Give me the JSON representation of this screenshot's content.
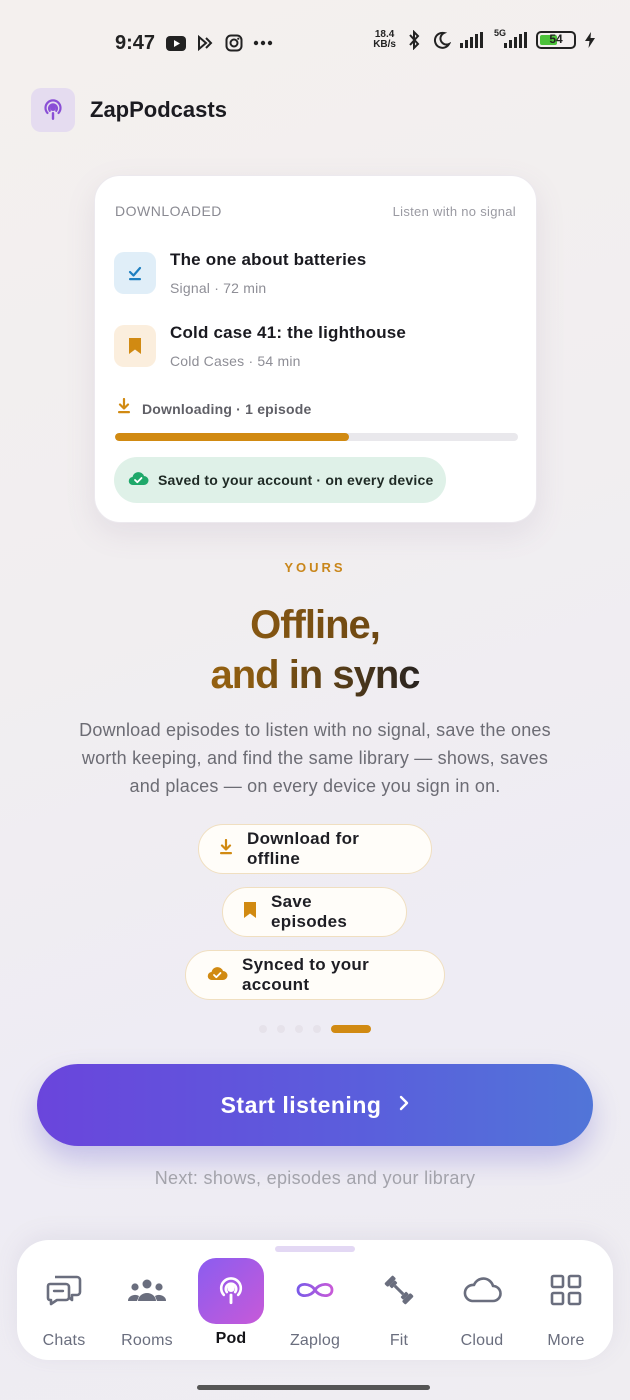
{
  "status": {
    "time": "9:47",
    "speed_top": "18.4",
    "speed_bottom": "KB/s",
    "network": "5G",
    "battery": "54",
    "icons_left": [
      "youtube-icon",
      "app-icon",
      "instagram-icon",
      "more-dots-icon"
    ],
    "icons_right": [
      "bluetooth-icon",
      "moon-icon",
      "signal-icon",
      "signal-5g-icon",
      "battery-icon",
      "charging-icon"
    ]
  },
  "app": {
    "name": "ZapPodcasts",
    "logo_icon": "podcast-icon"
  },
  "card": {
    "label": "DOWNLOADED",
    "sublabel": "Listen with no signal",
    "episodes": [
      {
        "title": "The one about batteries",
        "meta": "Signal · 72 min",
        "icon": "check-download-icon",
        "color": "#1e7fc0",
        "bg": "#e0eef8"
      },
      {
        "title": "Cold case 41: the lighthouse",
        "meta": "Cold Cases · 54 min",
        "icon": "bookmark-icon",
        "color": "#d18a12",
        "bg": "#fbeedd"
      }
    ],
    "downloading": "Downloading · 1 episode",
    "progress": 0.58,
    "saved": "Saved to your account · on every device"
  },
  "hero": {
    "kicker": "YOURS",
    "line1": "Offline,",
    "line2": "and in sync",
    "description": "Download episodes to listen with no signal, save the ones worth keeping, and find the same library — shows, saves and places — on every device you sign in on."
  },
  "chips": [
    {
      "label": "Download for offline",
      "icon": "download-icon"
    },
    {
      "label": "Save episodes",
      "icon": "bookmark-icon"
    },
    {
      "label": "Synced to your account",
      "icon": "cloud-check-icon"
    }
  ],
  "pager": {
    "count": 5,
    "active": 4
  },
  "cta": {
    "label": "Start listening",
    "icon": "chevron-right-icon"
  },
  "next_hint": "Next: shows, episodes and your library",
  "nav": [
    {
      "label": "Chats",
      "icon": "chat-icon"
    },
    {
      "label": "Rooms",
      "icon": "people-icon"
    },
    {
      "label": "Pod",
      "icon": "podcast-icon",
      "active": true
    },
    {
      "label": "Zaplog",
      "icon": "infinity-icon"
    },
    {
      "label": "Fit",
      "icon": "dumbbell-icon"
    },
    {
      "label": "Cloud",
      "icon": "cloud-icon"
    },
    {
      "label": "More",
      "icon": "grid-icon"
    }
  ],
  "colors": {
    "accent": "#d18a12",
    "primary": "#6a45dc",
    "success": "#1fa86a"
  }
}
